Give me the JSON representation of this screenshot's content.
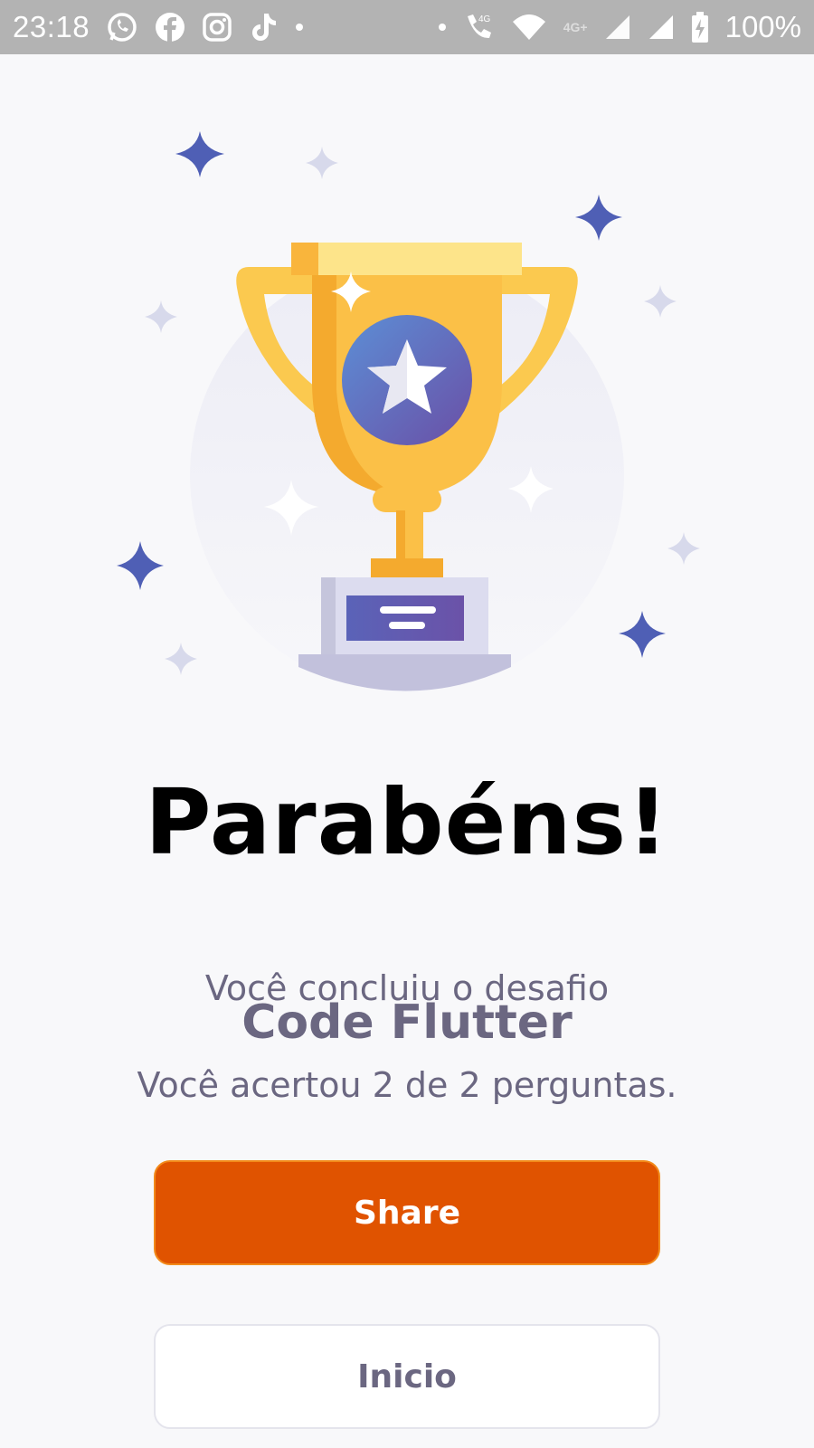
{
  "status_bar": {
    "time": "23:18",
    "left_icons": [
      "whatsapp-icon",
      "facebook-icon",
      "instagram-icon",
      "tiktok-icon",
      "dot"
    ],
    "network_label": "4G",
    "network_label_2": "4G+",
    "battery": "100%"
  },
  "result": {
    "title": "Parabéns!",
    "line1": "Você concluiu o desafio",
    "challenge_name": "Code Flutter",
    "score_text": "Você acertou 2 de 2 perguntas."
  },
  "buttons": {
    "share_label": "Share",
    "home_label": "Inicio"
  },
  "colors": {
    "share_bg": "#e05300",
    "share_border": "#f28a1a",
    "text_muted": "#6b6781",
    "trophy_gold": "#fbc047",
    "star_blue": "#4f5fb5"
  }
}
